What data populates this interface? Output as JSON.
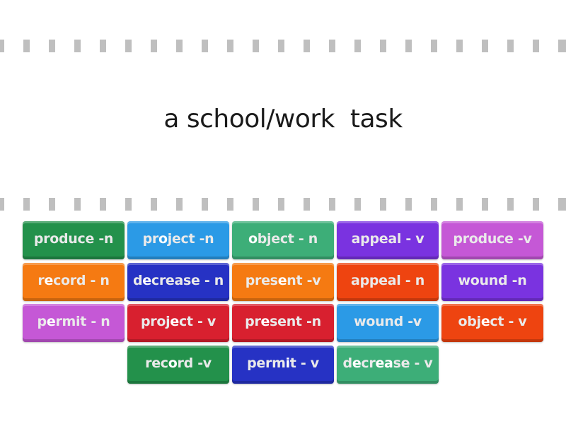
{
  "prompt": "a school/work  task",
  "tiles": [
    {
      "parts": [
        "produce -n",
        "",
        ""
      ],
      "color": "#23914b",
      "row": 0,
      "col": 0
    },
    {
      "parts": [
        "pr",
        "o",
        "ject -n"
      ],
      "color": "#2b9ae6",
      "row": 0,
      "col": 1
    },
    {
      "parts": [
        "",
        "o",
        "bject - n"
      ],
      "color": "#3dae78",
      "row": 0,
      "col": 2
    },
    {
      "parts": [
        "appeal - v",
        "",
        ""
      ],
      "color": "#7a33e0",
      "row": 0,
      "col": 3
    },
    {
      "parts": [
        "produce -v",
        "",
        ""
      ],
      "color": "#c558d6",
      "row": 0,
      "col": 4
    },
    {
      "parts": [
        "r",
        "e",
        "cord - n"
      ],
      "color": "#f57a12",
      "row": 1,
      "col": 0
    },
    {
      "parts": [
        "d",
        "e",
        "crease - n"
      ],
      "color": "#2632c4",
      "row": 1,
      "col": 1
    },
    {
      "parts": [
        "pres",
        "e",
        "nt -v"
      ],
      "color": "#f57a12",
      "row": 1,
      "col": 2
    },
    {
      "parts": [
        "appeal - n",
        "",
        ""
      ],
      "color": "#ee4410",
      "row": 1,
      "col": 3
    },
    {
      "parts": [
        "wound -n",
        "",
        ""
      ],
      "color": "#7a33e0",
      "row": 1,
      "col": 4
    },
    {
      "parts": [
        "p",
        "e",
        "rmit - n"
      ],
      "color": "#c558d6",
      "row": 2,
      "col": 0
    },
    {
      "parts": [
        "proj",
        "e",
        "ct - v"
      ],
      "color": "#d8202f",
      "row": 2,
      "col": 1
    },
    {
      "parts": [
        "pr",
        "e",
        "sent -n"
      ],
      "color": "#d8202f",
      "row": 2,
      "col": 2
    },
    {
      "parts": [
        "wound -v",
        "",
        ""
      ],
      "color": "#2b9ae6",
      "row": 2,
      "col": 3
    },
    {
      "parts": [
        "obj",
        "e",
        "ct - v"
      ],
      "color": "#ee4410",
      "row": 2,
      "col": 4
    },
    {
      "parts": [
        "rec",
        "o",
        "rd -v"
      ],
      "color": "#23914b",
      "row": 3,
      "col": 1
    },
    {
      "parts": [
        "perm",
        "i",
        "t - v"
      ],
      "color": "#2632c4",
      "row": 3,
      "col": 2
    },
    {
      "parts": [
        "d",
        "e",
        "cr",
        "ea",
        "se - v"
      ],
      "color": "#3dae78",
      "row": 3,
      "col": 3
    }
  ]
}
